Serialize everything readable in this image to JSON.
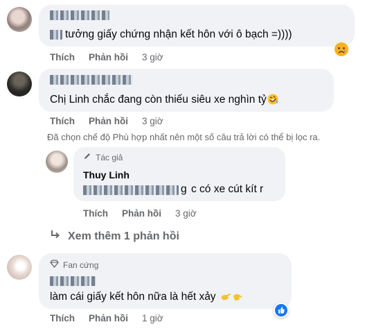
{
  "comments": [
    {
      "text": "tưởng giấy chứng nhận kết hôn với ô bạch =))))",
      "actions": {
        "like": "Thích",
        "reply": "Phản hồi",
        "time": "3 giờ"
      },
      "reaction_icon": "sad-face-icon"
    },
    {
      "text": "Chị Linh chắc đang còn thiếu siêu xe nghìn tỷ",
      "emoji_icon": "rolling-laughing-icon",
      "actions": {
        "like": "Thích",
        "reply": "Phản hồi",
        "time": "3 giờ"
      }
    },
    {
      "badge": "Fan cứng",
      "badge_icon": "diamond-icon",
      "text": "làm cái giấy kết hôn nữa là hết xảy",
      "emoji_icon": "pointing-hands-icon",
      "actions": {
        "like": "Thích",
        "reply": "Phản hồi",
        "time": "1 giờ"
      },
      "reaction_icon": "like-icon"
    }
  ],
  "filter_notice": "Đã chọn chế độ Phù hợp nhất nên một số câu trả lời có thể bị lọc ra.",
  "reply": {
    "badge": "Tác giả",
    "badge_icon": "pencil-icon",
    "author": "Thuy Linh",
    "text_visible_start": "g",
    "text": "c có xe cút kít r",
    "actions": {
      "like": "Thích",
      "reply": "Phản hồi",
      "time": "3 giờ"
    }
  },
  "see_more": "Xem thêm 1 phản hồi",
  "colors": {
    "bubble": "#f0f2f5",
    "muted": "#65676b",
    "like_blue": "#1877f2"
  }
}
